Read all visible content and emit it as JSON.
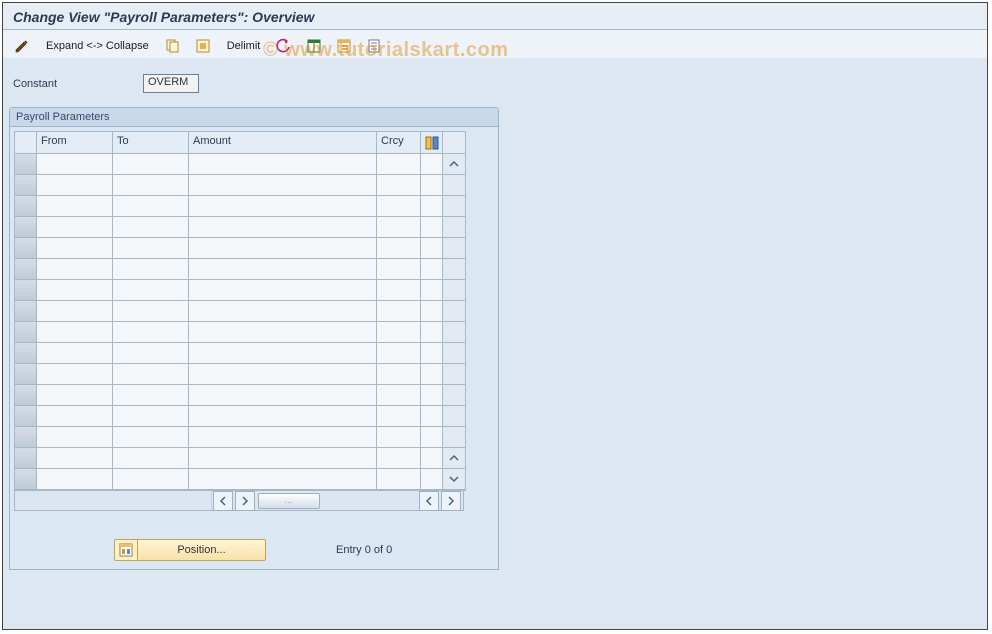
{
  "title": "Change View \"Payroll Parameters\": Overview",
  "watermark": "© www.tutorialskart.com",
  "toolbar": {
    "expand_collapse_label": "Expand <-> Collapse",
    "delimit_label": "Delimit"
  },
  "constant": {
    "label": "Constant",
    "value": "OVERM"
  },
  "panel": {
    "title": "Payroll Parameters",
    "columns": [
      "From",
      "To",
      "Amount",
      "Crcy"
    ],
    "rowCount": 16
  },
  "footer": {
    "position_label": "Position...",
    "entry_text": "Entry 0 of 0"
  }
}
